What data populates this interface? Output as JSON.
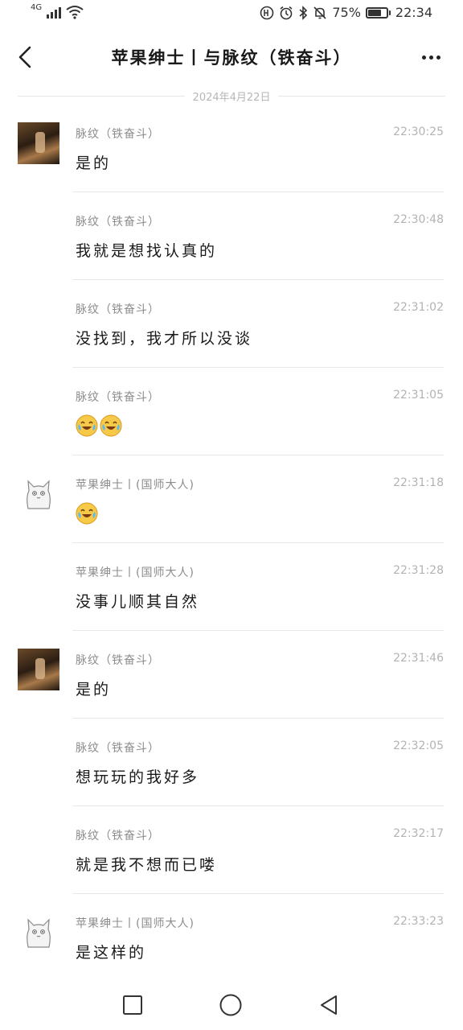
{
  "status_bar": {
    "network": "4G",
    "battery": "75%",
    "battery_level": 0.75,
    "time": "22:34",
    "icons": [
      "signal-icon",
      "wifi-icon",
      "hd-icon",
      "alarm-icon",
      "bluetooth-icon",
      "mute-icon",
      "battery-icon"
    ]
  },
  "header": {
    "title": "苹果绅士丨与脉纹（铁奋斗）"
  },
  "date_separator": "2024年4月22日",
  "messages": [
    {
      "sender": "脉纹（铁奋斗）",
      "time": "22:30:25",
      "text": "是的",
      "avatar": "photo-avatar"
    },
    {
      "sender": "脉纹（铁奋斗）",
      "time": "22:30:48",
      "text": "我就是想找认真的"
    },
    {
      "sender": "脉纹（铁奋斗）",
      "time": "22:31:02",
      "text": "没找到，我才所以没谈"
    },
    {
      "sender": "脉纹（铁奋斗）",
      "time": "22:31:05",
      "text": "",
      "emoji": [
        "laugh-cry-emoji",
        "laugh-cry-emoji"
      ]
    },
    {
      "sender": "苹果绅士丨(国师大人)",
      "time": "22:31:18",
      "text": "",
      "avatar": "cat-avatar",
      "emoji": [
        "laugh-cry-emoji"
      ]
    },
    {
      "sender": "苹果绅士丨(国师大人)",
      "time": "22:31:28",
      "text": "没事儿顺其自然"
    },
    {
      "sender": "脉纹（铁奋斗）",
      "time": "22:31:46",
      "text": "是的",
      "avatar": "photo-avatar"
    },
    {
      "sender": "脉纹（铁奋斗）",
      "time": "22:32:05",
      "text": "想玩玩的我好多"
    },
    {
      "sender": "脉纹（铁奋斗）",
      "time": "22:32:17",
      "text": "就是我不想而已喽"
    },
    {
      "sender": "苹果绅士丨(国师大人)",
      "time": "22:33:23",
      "text": "是这样的",
      "avatar": "cat-avatar"
    }
  ],
  "bottom_nav": {
    "icons": [
      "recent-apps-icon",
      "home-icon",
      "back-icon"
    ]
  },
  "colors": {
    "time_text": "#b3b3b3",
    "sender_text": "#8c8c8c",
    "divider": "#e8e8e8"
  }
}
